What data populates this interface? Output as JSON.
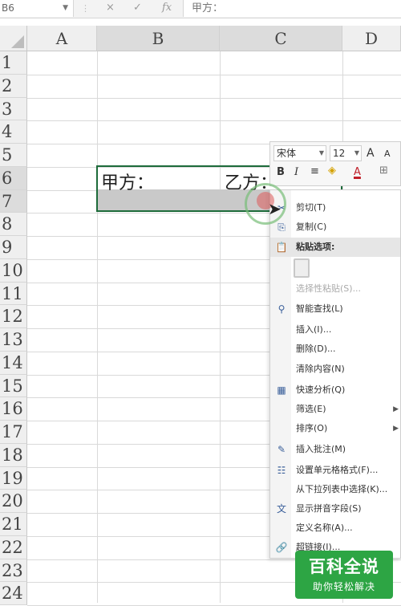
{
  "formula_bar": {
    "name_box": "B6",
    "cancel_icon": "×",
    "enter_icon": "✓",
    "fx_label": "fx",
    "formula_value": "甲方："
  },
  "columns": [
    "A",
    "B",
    "C",
    "D"
  ],
  "rows": [
    "1",
    "2",
    "3",
    "4",
    "5",
    "6",
    "7",
    "8",
    "9",
    "10",
    "11",
    "12",
    "13",
    "14",
    "15",
    "16",
    "17",
    "18",
    "19",
    "20",
    "21",
    "22",
    "23",
    "24"
  ],
  "cells": {
    "B6": "甲方：",
    "C6": "乙方："
  },
  "mini_toolbar": {
    "font": "宋体",
    "size": "12",
    "grow_font": "A",
    "shrink_font": "A",
    "bold": "B",
    "italic": "I",
    "align": "≡",
    "font_color": "A"
  },
  "context_menu": {
    "items": [
      {
        "label": "剪切(T)",
        "icon": "scissors-icon",
        "glyph": "✂"
      },
      {
        "label": "复制(C)",
        "icon": "copy-icon",
        "glyph": "⎘"
      },
      {
        "label": "粘贴选项:",
        "icon": "paste-icon",
        "glyph": "📋"
      },
      {
        "label": "选择性粘贴(S)...",
        "icon": "",
        "glyph": ""
      },
      {
        "label": "智能查找(L)",
        "icon": "smart-lookup-icon",
        "glyph": "⚲"
      },
      {
        "label": "插入(I)...",
        "icon": "",
        "glyph": ""
      },
      {
        "label": "删除(D)...",
        "icon": "",
        "glyph": ""
      },
      {
        "label": "清除内容(N)",
        "icon": "",
        "glyph": ""
      },
      {
        "label": "快速分析(Q)",
        "icon": "quick-analysis-icon",
        "glyph": "▦"
      },
      {
        "label": "筛选(E)",
        "icon": "",
        "glyph": ""
      },
      {
        "label": "排序(O)",
        "icon": "",
        "glyph": ""
      },
      {
        "label": "插入批注(M)",
        "icon": "insert-comment-icon",
        "glyph": "✎"
      },
      {
        "label": "设置单元格格式(F)...",
        "icon": "format-cells-icon",
        "glyph": "☷"
      },
      {
        "label": "从下拉列表中选择(K)...",
        "icon": "",
        "glyph": ""
      },
      {
        "label": "显示拼音字段(S)",
        "icon": "phonetic-icon",
        "glyph": "文"
      },
      {
        "label": "定义名称(A)...",
        "icon": "",
        "glyph": ""
      },
      {
        "label": "超链接(I)...",
        "icon": "hyperlink-icon",
        "glyph": "🔗"
      }
    ]
  },
  "watermark": {
    "title": "百科全说",
    "subtitle": "助你轻松解决"
  },
  "colors": {
    "selection_border": "#1d6b3a",
    "logo_green": "#2da544"
  }
}
